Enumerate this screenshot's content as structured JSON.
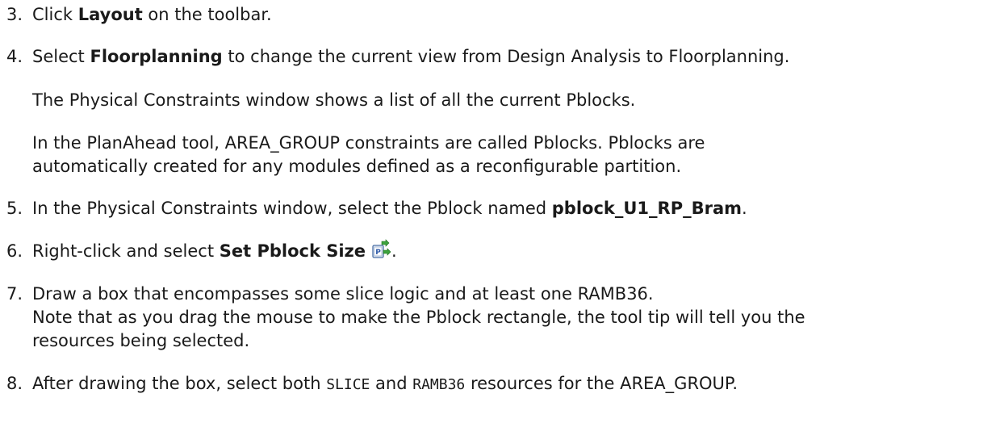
{
  "steps": {
    "s3": {
      "num": "3.",
      "t1": "Click ",
      "b1": "Layout",
      "t2": " on the toolbar."
    },
    "s4": {
      "num": "4.",
      "t1": "Select ",
      "b1": "Floorplanning",
      "t2": " to change the current view from Design Analysis to Floorplanning."
    },
    "p1": "The Physical Constraints window shows a list of all the current Pblocks.",
    "p2a": "In the PlanAhead tool, AREA_GROUP constraints are called Pblocks. Pblocks are",
    "p2b": "automatically created for any modules defined as a reconfigurable partition.",
    "s5": {
      "num": "5.",
      "t1": "In the Physical Constraints window, select the Pblock named ",
      "b1": "pblock_U1_RP_Bram",
      "t2": "."
    },
    "s6": {
      "num": "6.",
      "t1": "Right-click and select ",
      "b1": "Set Pblock Size",
      "t2": ".",
      "icon": "set-pblock-size-icon"
    },
    "s7": {
      "num": "7.",
      "l1": "Draw a box that encompasses some slice logic and at least one RAMB36.",
      "l2": "Note that as you drag the mouse to make the Pblock rectangle, the tool tip will tell you the",
      "l3": "resources being selected."
    },
    "s8": {
      "num": "8.",
      "t1": "After drawing the box, select both ",
      "m1": "SLICE",
      "t2": " and ",
      "m2": "RAMB36",
      "t3": " resources for the AREA_GROUP."
    }
  }
}
